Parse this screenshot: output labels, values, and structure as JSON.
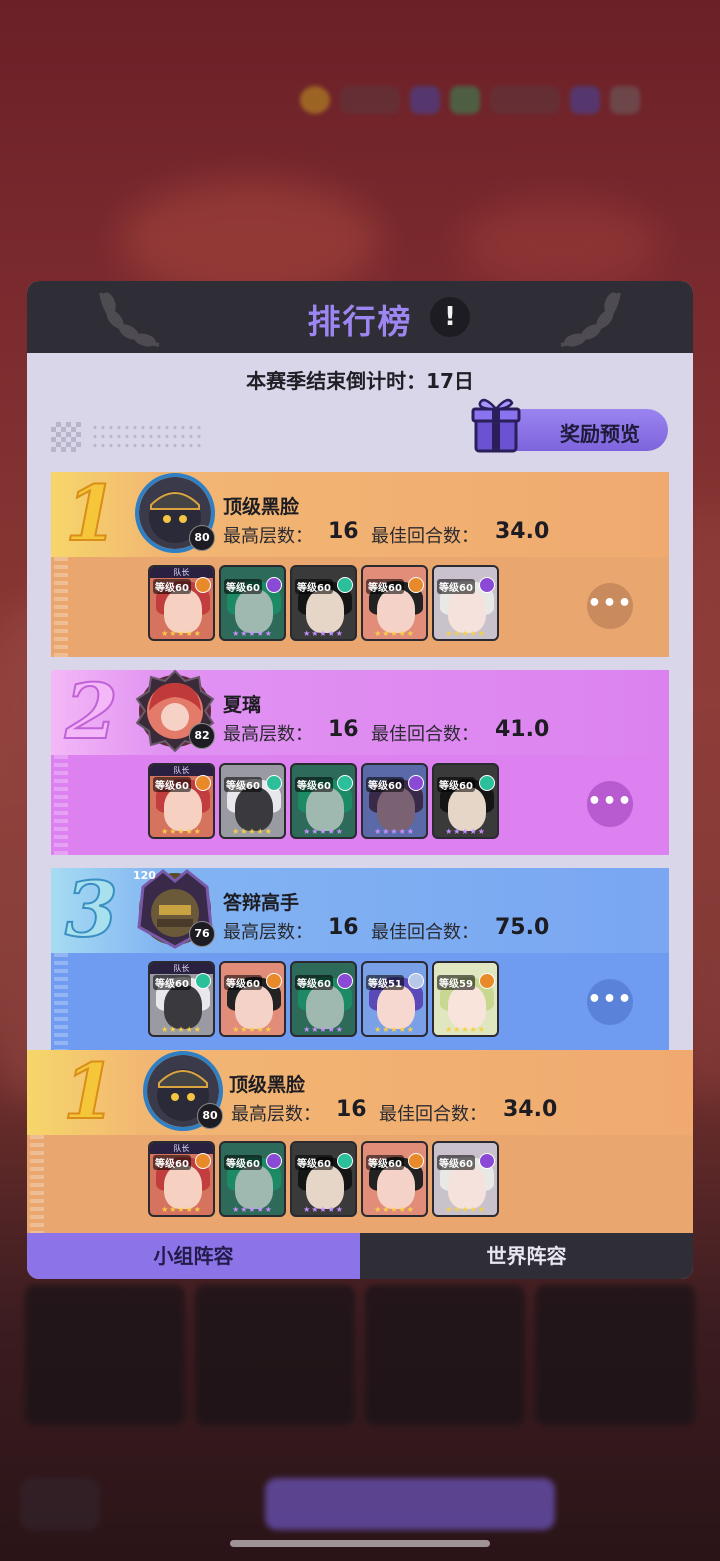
{
  "modal": {
    "title": "排行榜",
    "info_label": "!",
    "countdown": "本赛季结束倒计时：17日",
    "reward_button": "奖励预览"
  },
  "labels": {
    "max_floor": "最高层数：",
    "best_round": "最佳回合数：",
    "captain": "队长",
    "more": "•••"
  },
  "colors": {
    "rank1": "#f0aa70",
    "rank2": "#dc82f0",
    "rank3": "#7aa6f2",
    "accent": "#8c74e8"
  },
  "rankings": [
    {
      "rank": "1",
      "name": "顶级黑脸",
      "level": "80",
      "max_floor": "16",
      "best_round": "34.0",
      "heroes": [
        {
          "level": "等级60",
          "captain": true,
          "element": "gear-icon"
        },
        {
          "level": "等级60",
          "captain": false,
          "element": "void-icon"
        },
        {
          "level": "等级60",
          "captain": false,
          "element": "swirl-icon"
        },
        {
          "level": "等级60",
          "captain": false,
          "element": "gear-icon"
        },
        {
          "level": "等级60",
          "captain": false,
          "element": "void-icon"
        }
      ]
    },
    {
      "rank": "2",
      "name": "夏璃",
      "level": "82",
      "max_floor": "16",
      "best_round": "41.0",
      "heroes": [
        {
          "level": "等级60",
          "captain": true,
          "element": "gear-icon"
        },
        {
          "level": "等级60",
          "captain": false,
          "element": "swirl-icon"
        },
        {
          "level": "等级60",
          "captain": false,
          "element": "swirl-icon"
        },
        {
          "level": "等级60",
          "captain": false,
          "element": "void-icon"
        },
        {
          "level": "等级60",
          "captain": false,
          "element": "swirl-icon"
        }
      ]
    },
    {
      "rank": "3",
      "name": "答辩高手",
      "level": "76",
      "frame_level": "120",
      "max_floor": "16",
      "best_round": "75.0",
      "heroes": [
        {
          "level": "等级60",
          "captain": true,
          "element": "swirl-icon"
        },
        {
          "level": "等级60",
          "captain": false,
          "element": "gear-icon"
        },
        {
          "level": "等级60",
          "captain": false,
          "element": "void-icon"
        },
        {
          "level": "等级51",
          "captain": false,
          "element": "cross-icon"
        },
        {
          "level": "等级59",
          "captain": false,
          "element": "gear-icon"
        }
      ]
    }
  ],
  "my_rank": {
    "rank": "1",
    "name": "顶级黑脸",
    "level": "80",
    "max_floor": "16",
    "best_round": "34.0",
    "heroes": [
      {
        "level": "等级60",
        "captain": true,
        "element": "gear-icon"
      },
      {
        "level": "等级60",
        "captain": false,
        "element": "void-icon"
      },
      {
        "level": "等级60",
        "captain": false,
        "element": "swirl-icon"
      },
      {
        "level": "等级60",
        "captain": false,
        "element": "gear-icon"
      },
      {
        "level": "等级60",
        "captain": false,
        "element": "void-icon"
      }
    ]
  },
  "tabs": [
    "小组阵容",
    "世界阵容"
  ]
}
